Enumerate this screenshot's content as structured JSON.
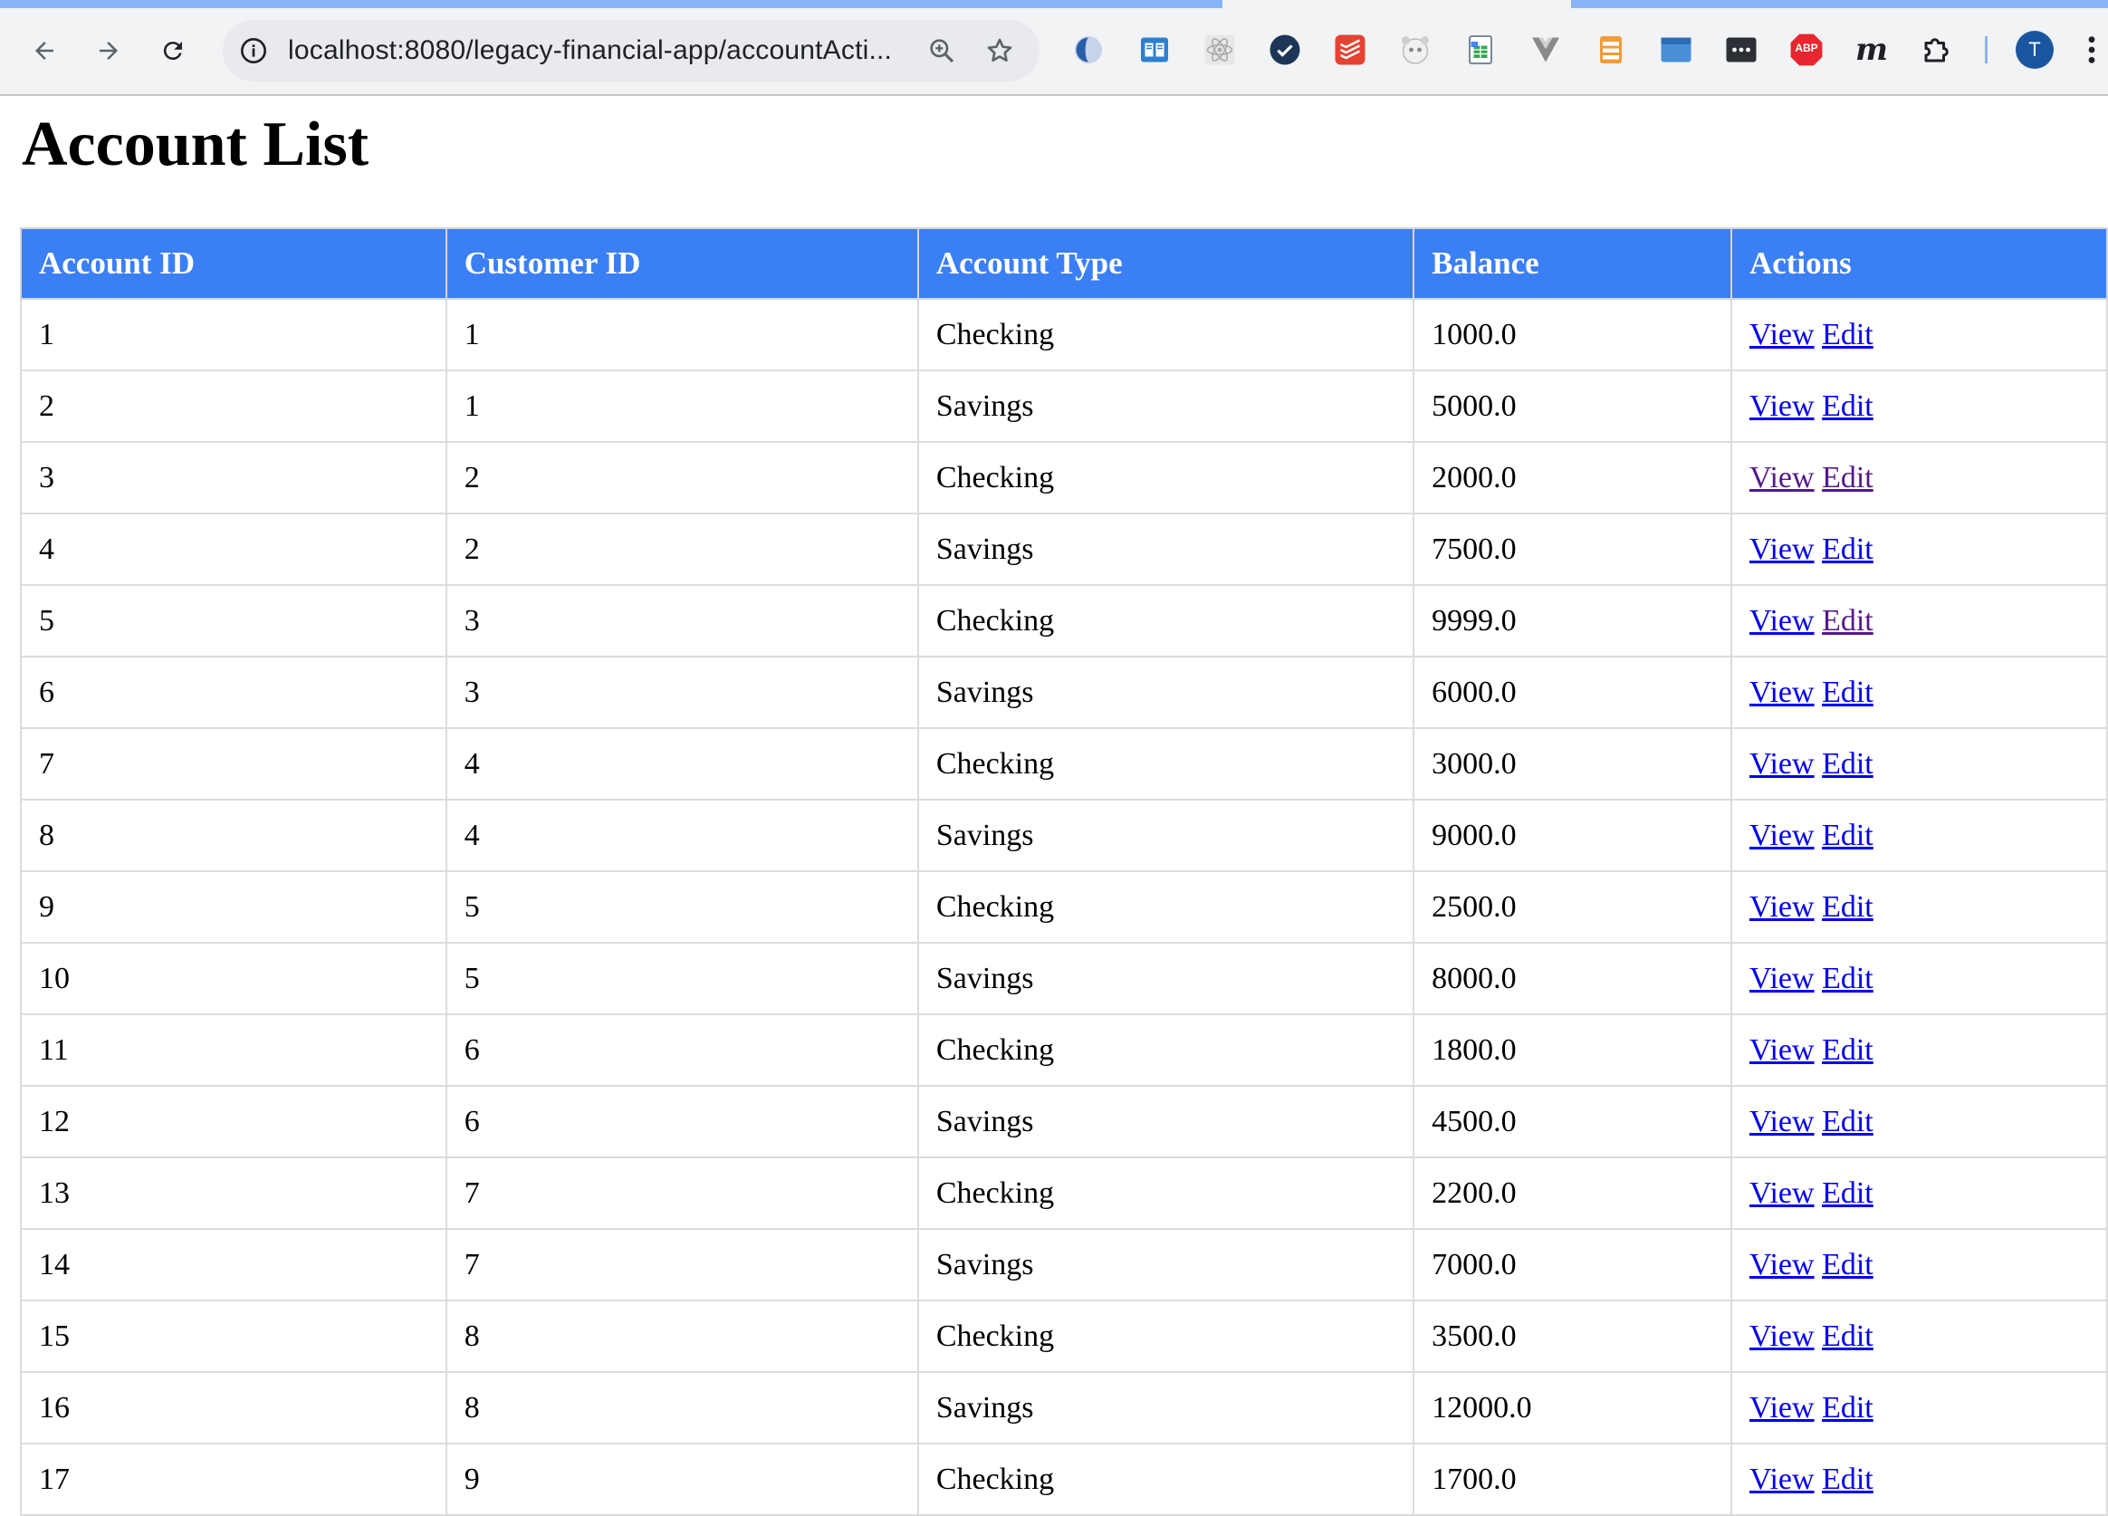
{
  "browser": {
    "url_host": "localhost",
    "url_path": ":8080/legacy-financial-app/accountActi...",
    "profile_initial": "T",
    "extensions": [
      "ext-1-icon",
      "reader-icon",
      "react-devtools-icon",
      "check-circle-icon",
      "todoist-icon",
      "panda-icon",
      "sheets-icon",
      "vuejs-icon",
      "notes-icon",
      "window-icon",
      "more-ext-icon",
      "abp-icon",
      "m-icon",
      "puzzle-icon"
    ],
    "abp_label": "ABP",
    "m_label": "m"
  },
  "page": {
    "title": "Account List"
  },
  "table": {
    "headers": [
      "Account ID",
      "Customer ID",
      "Account Type",
      "Balance",
      "Actions"
    ],
    "view_label": "View",
    "edit_label": "Edit",
    "rows": [
      {
        "account_id": "1",
        "customer_id": "1",
        "type": "Checking",
        "balance": "1000.0",
        "view_visited": false,
        "edit_visited": false
      },
      {
        "account_id": "2",
        "customer_id": "1",
        "type": "Savings",
        "balance": "5000.0",
        "view_visited": false,
        "edit_visited": false
      },
      {
        "account_id": "3",
        "customer_id": "2",
        "type": "Checking",
        "balance": "2000.0",
        "view_visited": true,
        "edit_visited": true
      },
      {
        "account_id": "4",
        "customer_id": "2",
        "type": "Savings",
        "balance": "7500.0",
        "view_visited": false,
        "edit_visited": false
      },
      {
        "account_id": "5",
        "customer_id": "3",
        "type": "Checking",
        "balance": "9999.0",
        "view_visited": false,
        "edit_visited": true
      },
      {
        "account_id": "6",
        "customer_id": "3",
        "type": "Savings",
        "balance": "6000.0",
        "view_visited": false,
        "edit_visited": false
      },
      {
        "account_id": "7",
        "customer_id": "4",
        "type": "Checking",
        "balance": "3000.0",
        "view_visited": false,
        "edit_visited": false
      },
      {
        "account_id": "8",
        "customer_id": "4",
        "type": "Savings",
        "balance": "9000.0",
        "view_visited": false,
        "edit_visited": false
      },
      {
        "account_id": "9",
        "customer_id": "5",
        "type": "Checking",
        "balance": "2500.0",
        "view_visited": false,
        "edit_visited": false
      },
      {
        "account_id": "10",
        "customer_id": "5",
        "type": "Savings",
        "balance": "8000.0",
        "view_visited": false,
        "edit_visited": false
      },
      {
        "account_id": "11",
        "customer_id": "6",
        "type": "Checking",
        "balance": "1800.0",
        "view_visited": false,
        "edit_visited": false
      },
      {
        "account_id": "12",
        "customer_id": "6",
        "type": "Savings",
        "balance": "4500.0",
        "view_visited": false,
        "edit_visited": false
      },
      {
        "account_id": "13",
        "customer_id": "7",
        "type": "Checking",
        "balance": "2200.0",
        "view_visited": false,
        "edit_visited": false
      },
      {
        "account_id": "14",
        "customer_id": "7",
        "type": "Savings",
        "balance": "7000.0",
        "view_visited": false,
        "edit_visited": false
      },
      {
        "account_id": "15",
        "customer_id": "8",
        "type": "Checking",
        "balance": "3500.0",
        "view_visited": false,
        "edit_visited": false
      },
      {
        "account_id": "16",
        "customer_id": "8",
        "type": "Savings",
        "balance": "12000.0",
        "view_visited": false,
        "edit_visited": false
      },
      {
        "account_id": "17",
        "customer_id": "9",
        "type": "Checking",
        "balance": "1700.0",
        "view_visited": false,
        "edit_visited": false
      }
    ]
  },
  "colors": {
    "header_bg": "#3b7ff5",
    "link": "#0000ee",
    "link_visited": "#551a8b"
  }
}
